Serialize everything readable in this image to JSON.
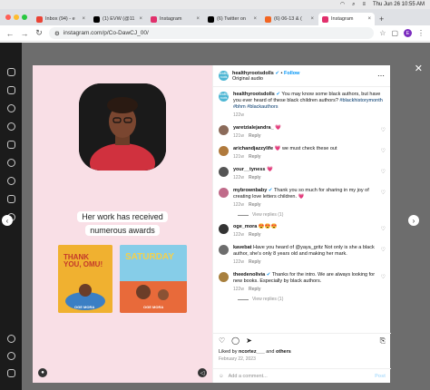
{
  "menubar": {
    "datetime": "Thu Jun 26  10:55 AM"
  },
  "tabs": [
    {
      "title": "Inbox (94) - e",
      "color": "#ea4335"
    },
    {
      "title": "(1) EVW (@11",
      "color": "#000000"
    },
    {
      "title": "Instagram",
      "color": "#e1306c"
    },
    {
      "title": "(6) Twitter on",
      "color": "#000000"
    },
    {
      "title": "(6) 06-13 & (",
      "color": "#f26522"
    },
    {
      "title": "Instagram",
      "color": "#e1306c",
      "active": true
    }
  ],
  "new_tab": "+",
  "toolbar": {
    "url": "instagram.com/p/Co-DawCJ_00/",
    "profile_initial": "E"
  },
  "post": {
    "media": {
      "headline_line1": "Her work has received",
      "headline_line2": "numerous awards",
      "book1_title": "THANK YOU, OMU!",
      "book1_author": "OGE MORA",
      "book2_title": "SATURDAY",
      "book2_author": "OGE MORA"
    },
    "header": {
      "username": "healthyrootsdolls",
      "follow": "Follow",
      "subtitle": "Original audio",
      "brand_badge": "healthy roots"
    },
    "caption": {
      "username": "healthyrootsdolls",
      "text": "You may know some black authors, but have you ever heard of these black children authors?",
      "hashtags": "#blackhistorymonth #bhm #blackauthors",
      "time": "122w"
    },
    "comments": [
      {
        "username": "yaretzialejandra_",
        "text": "💗",
        "time": "121w",
        "reply": "Reply",
        "color": "#8b6b5a"
      },
      {
        "username": "arichandjazzylife",
        "text": "💗 we must check these out",
        "time": "121w",
        "reply": "Reply",
        "color": "#b07a3d"
      },
      {
        "username": "your__tyness",
        "text": "💗",
        "time": "122w",
        "reply": "Reply",
        "color": "#555555"
      },
      {
        "username": "mybrownbaby",
        "text": "Thank you so much for sharing in my joy of creating love letters children. 💗",
        "time": "122w",
        "reply": "Reply",
        "color": "#c06b8a",
        "view_replies": "View replies (1)"
      },
      {
        "username": "oge_mora",
        "text": "😍😍😍",
        "time": "122w",
        "reply": "Reply",
        "color": "#333333"
      },
      {
        "username": "kavebat",
        "text": "Have you heard of @yaya_gritz Not only is she a black author, she's only 8 years old and making her mark.",
        "time": "122w",
        "reply": "Reply",
        "color": "#6d6d6d",
        "mention": "@yaya_gritz"
      },
      {
        "username": "theedenolivia",
        "text": "Thanks for the intro. We are always looking for new books. Especially by black authors.",
        "time": "122w",
        "reply": "Reply",
        "color": "#a8803e",
        "view_replies": "View replies (1)"
      }
    ],
    "likes": {
      "prefix": "Liked by ",
      "user": "ncortez___",
      "mid": " and ",
      "others": "others"
    },
    "date": "February 22, 2023",
    "add_comment": "Add a comment...",
    "post_button": "Post"
  }
}
